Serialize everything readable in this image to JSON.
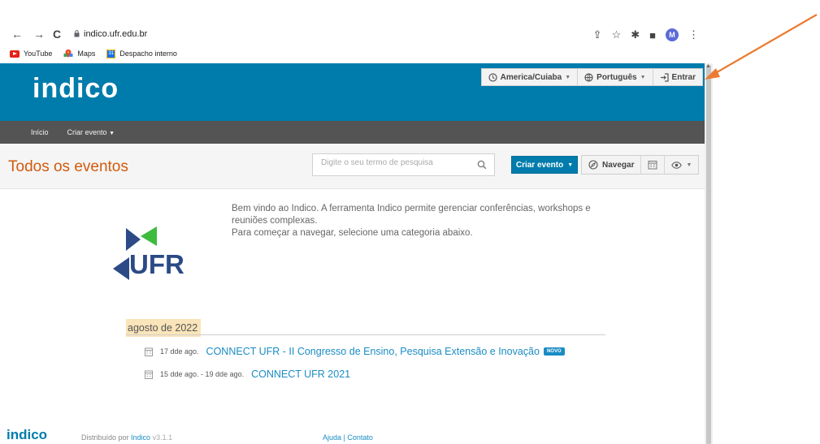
{
  "browser": {
    "url": "indico.ufr.edu.br",
    "profile_initial": "M",
    "bookmarks": [
      {
        "label": "YouTube",
        "icon": "youtube-icon"
      },
      {
        "label": "Maps",
        "icon": "maps-icon"
      },
      {
        "label": "Despacho interno",
        "icon": "calendar-icon"
      }
    ]
  },
  "header": {
    "logo": "indico",
    "timezone": "America/Cuiaba",
    "language": "Português",
    "login": "Entrar",
    "accent_color": "#007cac"
  },
  "menu": {
    "home": "Início",
    "create": "Criar evento"
  },
  "titlebar": {
    "title": "Todos os eventos",
    "search_placeholder": "Digite o seu termo de pesquisa",
    "create_button": "Criar evento",
    "navigate_button": "Navegar"
  },
  "welcome": {
    "line1": "Bem vindo ao Indico. A ferramenta Indico permite gerenciar conferências, workshops e reuniões complexas.",
    "line2": "Para começar a navegar, selecione uma categoria abaixo.",
    "logo_text": "UFR"
  },
  "events": {
    "month": "agosto de 2022",
    "items": [
      {
        "date": "17 dde ago.",
        "title": "CONNECT UFR - II Congresso de Ensino, Pesquisa Extensão e Inovação",
        "badge": "NOVO"
      },
      {
        "date": "15 dde ago. - 19 dde ago.",
        "title": "CONNECT UFR 2021",
        "badge": ""
      }
    ]
  },
  "footer": {
    "logo": "indico",
    "powered_prefix": "Distribuído por",
    "powered_link": "Indico",
    "version": "v3.1.1",
    "help": "Ajuda",
    "separator": "|",
    "contact": "Contato"
  }
}
